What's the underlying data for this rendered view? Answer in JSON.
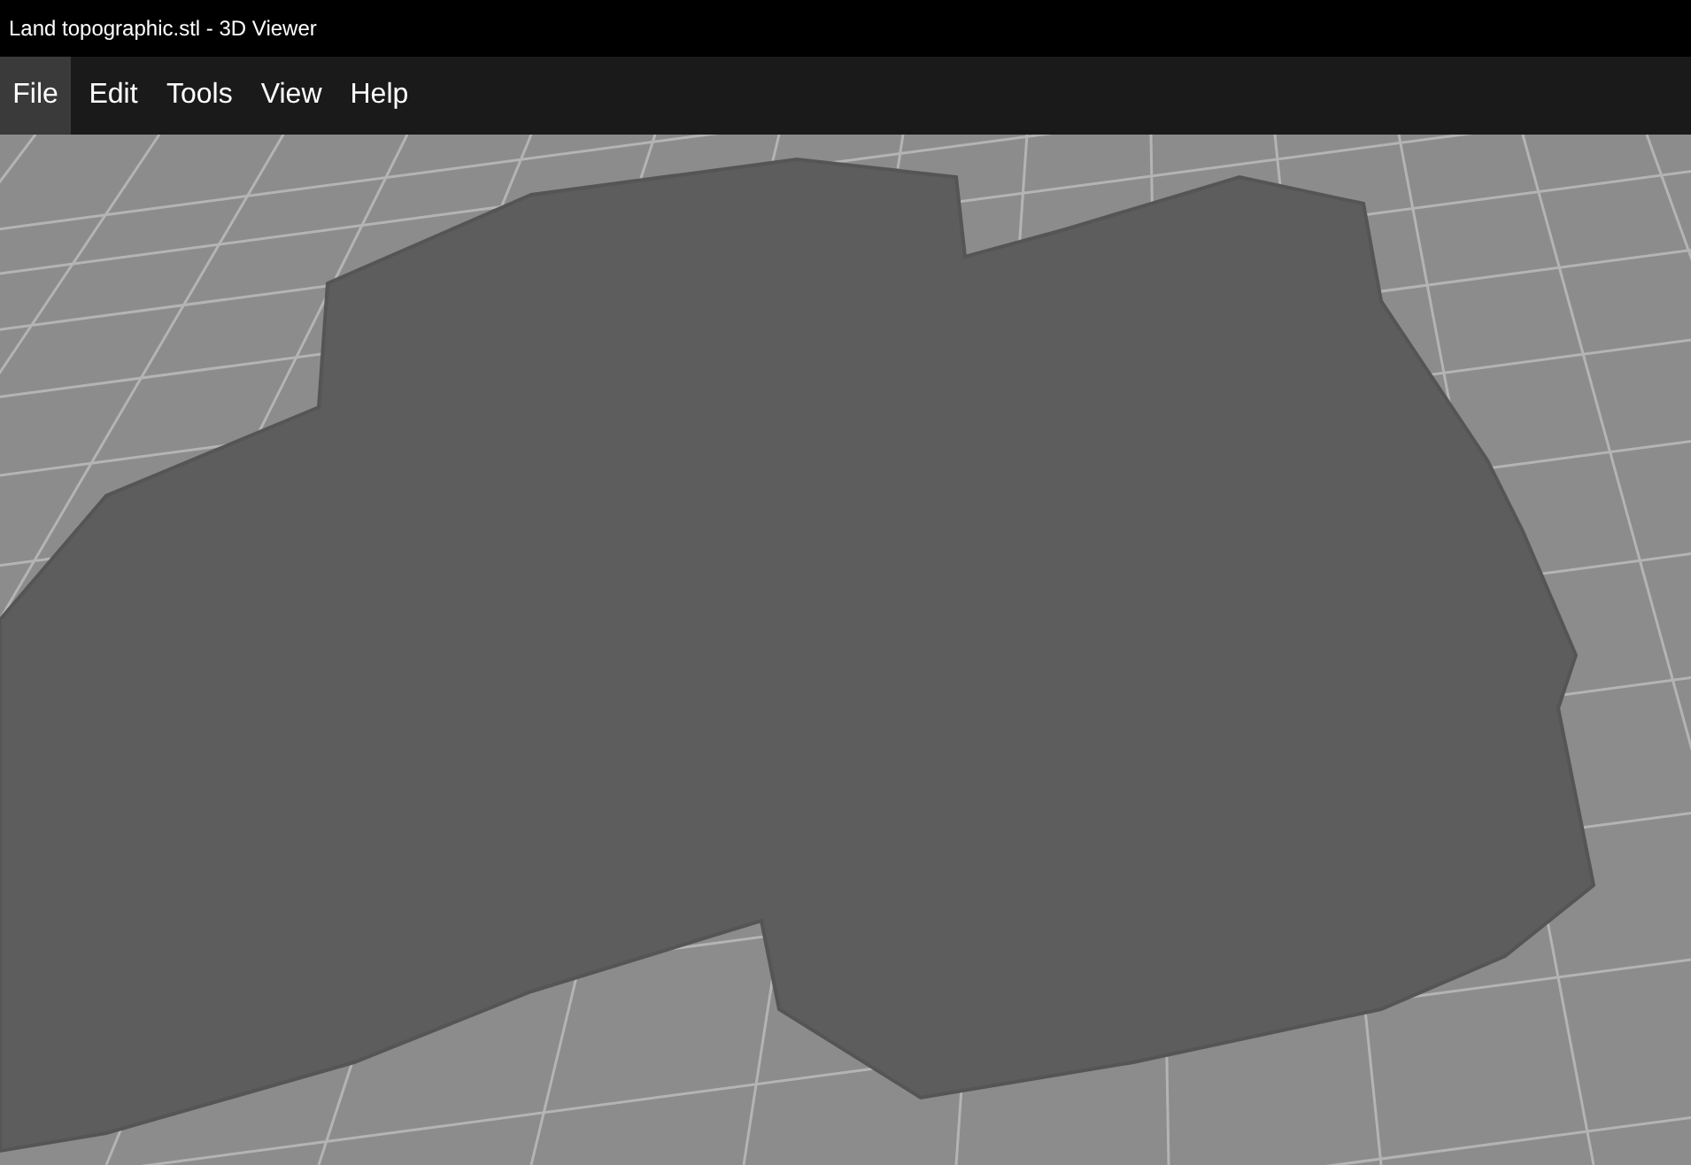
{
  "window": {
    "title": "Land topographic.stl - 3D Viewer"
  },
  "menu": [
    {
      "label": "File",
      "selected": true
    },
    {
      "label": "Edit",
      "selected": false
    },
    {
      "label": "Tools",
      "selected": false
    },
    {
      "label": "View",
      "selected": false
    },
    {
      "label": "Help",
      "selected": false
    }
  ]
}
